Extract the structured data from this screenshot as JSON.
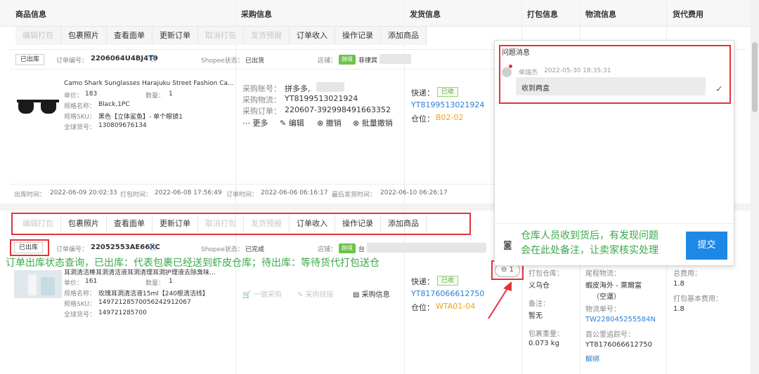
{
  "header": {
    "col_product": "商品信息",
    "col_purchase": "采购信息",
    "col_shipping": "发货信息",
    "col_packing": "打包信息",
    "col_logistics": "物流信息",
    "col_freight": "货代费用"
  },
  "toolbar": {
    "edit_pack": "编辑打包",
    "package_photos": "包裹照片",
    "view_waybill": "查看面单",
    "update_order": "更新订单",
    "cancel_pack": "取消打包",
    "ship_report": "发货预报",
    "order_income": "订单收入",
    "operation_log": "操作记录",
    "add_product": "添加商品"
  },
  "order1": {
    "status": "已出库",
    "order_no_label": "订单编号：",
    "order_no": "2206064U4BJ4T9",
    "shopee_label": "Shopee状态：",
    "shopee_status": "已出货",
    "store_label": "店铺：",
    "store_tag": "跨境",
    "store_name": "菲律宾",
    "product_title": "Camo Shark Sunglasses Harajuku Street Fashion Ca...",
    "price_label": "单价：",
    "price": "183",
    "qty_label": "数量：",
    "qty": "1",
    "spec_label": "规格名称：",
    "spec": "Black,1PC",
    "sku_label": "规格SKU：",
    "sku": "黑色【立体鲨鱼】- 单个眼镜1",
    "global_label": "全球货号：",
    "global_no": "130809676134",
    "purchase_account_label": "采购账号：",
    "purchase_account": "拼多多,",
    "purchase_logistics_label": "采购物流：",
    "purchase_logistics": "YT8199513021924",
    "purchase_order_label": "采购订单：",
    "purchase_order": "220607-392998491663352",
    "more": "更多",
    "edit": "编辑",
    "revoke": "撤销",
    "batch_revoke": "批量撤销",
    "express_label": "快递：",
    "received": "已收",
    "tracking": "YT8199513021924",
    "location_label": "仓位：",
    "location": "B02-02",
    "time_out_label": "出库时间：",
    "time_out": "2022-06-09 20:02:33",
    "time_pack_label": "打包时间：",
    "time_pack": "2022-06-08 17:56:49",
    "time_order_label": "订单时间：",
    "time_order": "2022-06-06 06:16:17",
    "time_last_label": "最后发货时间：",
    "time_last": "2022-06-10 06:26:17"
  },
  "order2": {
    "status": "已出库",
    "order_no_label": "订单编号：",
    "order_no": "22052553AE66XC",
    "shopee_label": "Shopee状态：",
    "shopee_status": "已完成",
    "store_label": "店铺：",
    "store_tag": "跨境",
    "store_name": "台",
    "product_title": "耳洞清洁棒耳洞清洁液耳洞清理耳洞护理液去除臭味...",
    "price_label": "单价：",
    "price": "161",
    "qty_label": "数量：",
    "qty": "1",
    "spec_label": "规格名称：",
    "spec": "玫瑰耳洞清洁液15ml【240根清洁线】",
    "sku_label": "规格SKU：",
    "sku": "1497212857005624291206​7",
    "global_label": "全球货号：",
    "global_no": "149721285700",
    "one_click_purchase": "一键采购",
    "purchase_link": "采购链接",
    "purchase_info": "采购信息",
    "express_label": "快递：",
    "received": "已收",
    "tracking": "YT8176066612750",
    "location_label": "仓位：",
    "location": "WTA01-04",
    "comment_count": "1",
    "pack_warehouse_label": "打包仓库：",
    "pack_warehouse": "义乌仓",
    "remark_label": "备注：",
    "remark": "暂无",
    "package_weight_label": "包裹重量：",
    "package_weight": "0.073 kg",
    "first_mile_label": "尾程物流：",
    "first_mile": "蝦皮海外 - 萊爾富",
    "first_mile_sub": "（空運）",
    "logistics_no_label": "物流单号：",
    "logistics_no": "TW228045255584N",
    "first_track_label": "首公里追踪号：",
    "first_track": "YT8176066612750",
    "unbind": "解绑",
    "total_fee_label": "总费用：",
    "total_fee": "1.8",
    "pack_fee_label": "打包基本费用：",
    "pack_fee": "1.8"
  },
  "panel": {
    "title": "问题消息",
    "sender": "单瑞杰",
    "time": "2022-05-30 18:35:31",
    "message": "收到两盒",
    "submit": "提交"
  },
  "annotations": {
    "status_note": "订单出库状态查询，已出库：代表包裹已经送到虾皮仓库；待出库：等待货代打包送仓",
    "warehouse_note_line1": "仓库人员收到货后，有发现问题",
    "warehouse_note_line2": "会在此处备注，让卖家核实处理"
  },
  "colors": {
    "highlight_red": "#e5323a",
    "annotation_green": "#3aa94a",
    "primary_blue": "#1e88e5",
    "link_blue": "#2a7ed6",
    "location_orange": "#f0a020",
    "tag_green": "#6cc24a"
  }
}
